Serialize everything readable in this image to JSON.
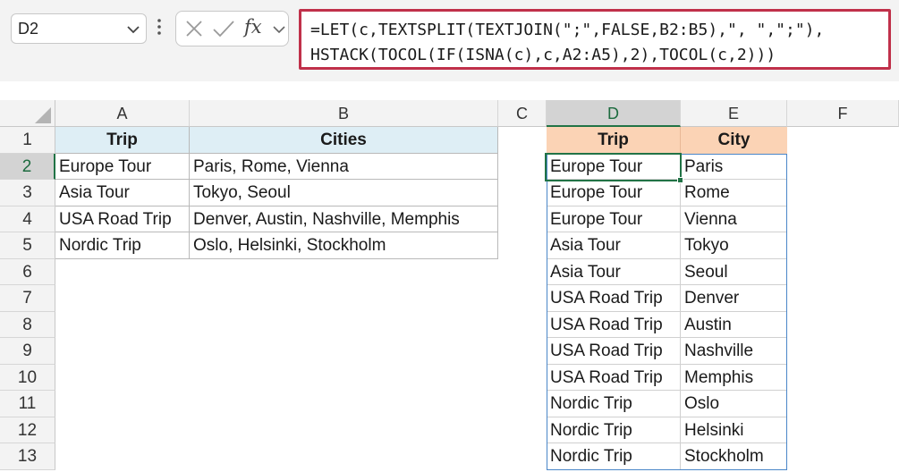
{
  "name_box": {
    "value": "D2"
  },
  "formula_bar": {
    "fx_label": "fx",
    "line1": "=LET(c,TEXTSPLIT(TEXTJOIN(\";\",FALSE,B2:B5),\", \",\";\"),",
    "line2": "HSTACK(TOCOL(IF(ISNA(c),c,A2:A5),2),TOCOL(c,2)))"
  },
  "columns": [
    "A",
    "B",
    "C",
    "D",
    "E",
    "F"
  ],
  "rows": [
    "1",
    "2",
    "3",
    "4",
    "5",
    "6",
    "7",
    "8",
    "9",
    "10",
    "11",
    "12",
    "13"
  ],
  "source_table": {
    "headers": [
      "Trip",
      "Cities"
    ],
    "rows": [
      [
        "Europe Tour",
        "Paris, Rome, Vienna"
      ],
      [
        "Asia Tour",
        "Tokyo, Seoul"
      ],
      [
        "USA Road Trip",
        "Denver, Austin, Nashville, Memphis"
      ],
      [
        "Nordic Trip",
        "Oslo, Helsinki, Stockholm"
      ]
    ]
  },
  "result_table": {
    "headers": [
      "Trip",
      "City"
    ],
    "rows": [
      [
        "Europe Tour",
        "Paris"
      ],
      [
        "Europe Tour",
        "Rome"
      ],
      [
        "Europe Tour",
        "Vienna"
      ],
      [
        "Asia Tour",
        "Tokyo"
      ],
      [
        "Asia Tour",
        "Seoul"
      ],
      [
        "USA Road Trip",
        "Denver"
      ],
      [
        "USA Road Trip",
        "Austin"
      ],
      [
        "USA Road Trip",
        "Nashville"
      ],
      [
        "USA Road Trip",
        "Memphis"
      ],
      [
        "Nordic Trip",
        "Oslo"
      ],
      [
        "Nordic Trip",
        "Helsinki"
      ],
      [
        "Nordic Trip",
        "Stockholm"
      ]
    ]
  },
  "colors": {
    "selection_green": "#217346",
    "header_blue": "#deeef5",
    "header_orange": "#fbd3b5",
    "formula_border": "#c0304a",
    "spill_border": "#4a86c8"
  }
}
